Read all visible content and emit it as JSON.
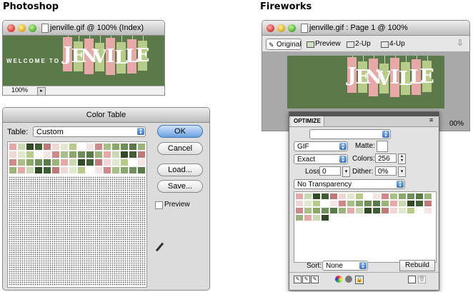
{
  "headings": {
    "photoshop": "Photoshop",
    "fireworks": "Fireworks"
  },
  "ps_doc": {
    "title": "jenville.gif @ 100% (Index)",
    "zoom": "100%",
    "banner_welcome": "WELCOME TO",
    "banner_letters": [
      "J",
      "E",
      "N",
      "V",
      "I",
      "L",
      "L",
      "E"
    ]
  },
  "color_table": {
    "title": "Color Table",
    "table_label": "Table:",
    "table_value": "Custom",
    "ok": "OK",
    "cancel": "Cancel",
    "load": "Load...",
    "save": "Save...",
    "preview": "Preview"
  },
  "fw_doc": {
    "title": "jenville.gif : Page 1 @ 100%",
    "tabs": [
      "Original",
      "Preview",
      "2-Up",
      "4-Up"
    ],
    "zoom_partial": "00%",
    "banner_letters": [
      "J",
      "E",
      "N",
      "V",
      "I",
      "L",
      "L",
      "E"
    ]
  },
  "optimize": {
    "title": "OPTIMIZE",
    "preset": "",
    "format": "GIF",
    "matte_label": "Matte:",
    "palette": "Exact",
    "colors_label": "Colors:",
    "colors_value": "256",
    "loss_label": "Loss:",
    "loss_value": "0",
    "dither_label": "Dither:",
    "dither_value": "0%",
    "transparency": "No Transparency",
    "sort_label": "Sort:",
    "sort_value": "None",
    "rebuild": "Rebuild"
  },
  "colors": {
    "banner_green": "#5a7a4a",
    "pink": "#e8a8a8",
    "light_green": "#b8cc8a",
    "dark_green": "#3f5f32",
    "accent_blue": "#3a70c8"
  }
}
